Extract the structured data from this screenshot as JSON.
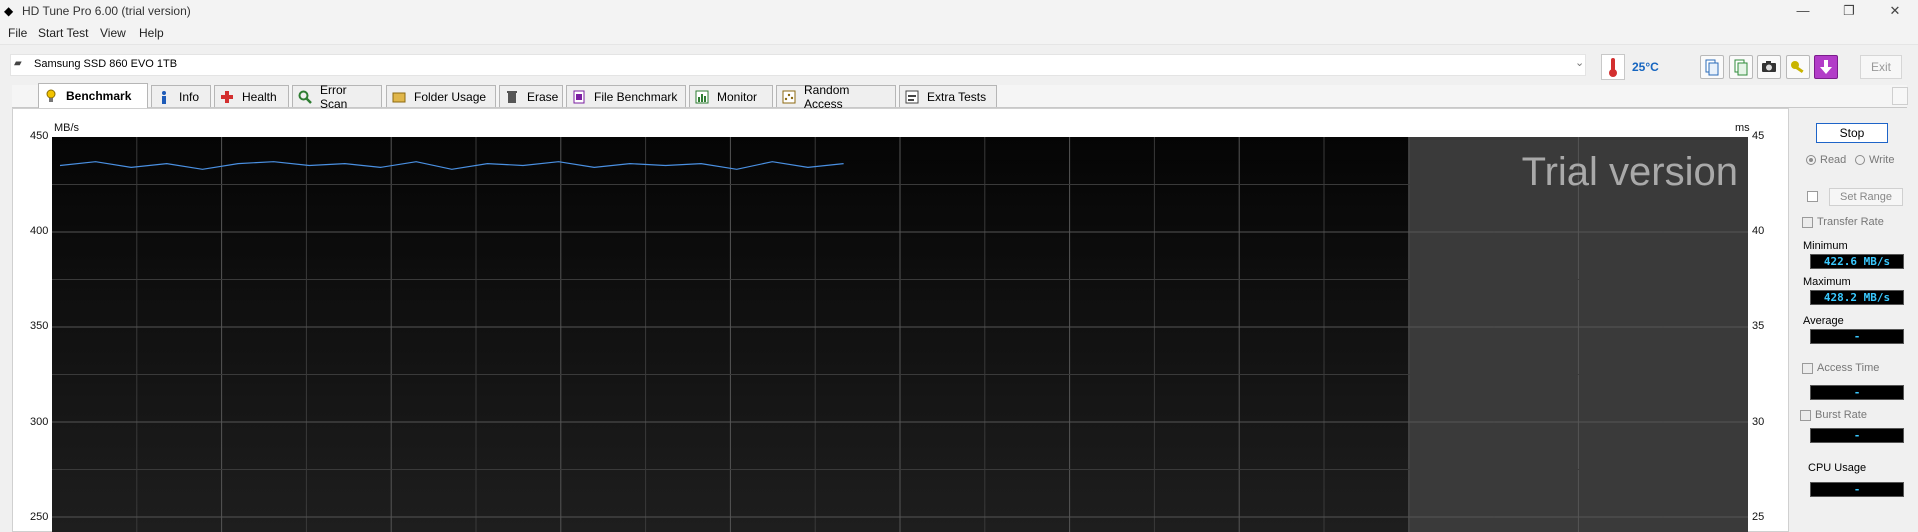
{
  "window": {
    "title": "HD Tune Pro 6.00 (trial version)",
    "minimize": "—",
    "maximize": "❐",
    "close": "✕"
  },
  "menu": [
    "File",
    "Start Test",
    "View",
    "Help"
  ],
  "toolbar": {
    "drive": "Samsung SSD 860 EVO 1TB",
    "temperature": "25°C",
    "exit_label": "Exit",
    "icons": [
      "copy-text-icon",
      "copy-info-icon",
      "screenshot-camera-icon",
      "key-icon",
      "download-arrow-icon"
    ]
  },
  "tabs": [
    {
      "label": "Benchmark",
      "icon": "bulb-icon",
      "active": true
    },
    {
      "label": "Info",
      "icon": "info-icon"
    },
    {
      "label": "Health",
      "icon": "health-cross-icon"
    },
    {
      "label": "Error Scan",
      "icon": "magnifier-icon"
    },
    {
      "label": "Folder Usage",
      "icon": "folder-icon"
    },
    {
      "label": "Erase",
      "icon": "trash-icon"
    },
    {
      "label": "File Benchmark",
      "icon": "file-benchmark-icon"
    },
    {
      "label": "Monitor",
      "icon": "monitor-icon"
    },
    {
      "label": "Random Access",
      "icon": "random-access-icon"
    },
    {
      "label": "Extra Tests",
      "icon": "extra-tests-icon"
    }
  ],
  "chart_data": {
    "type": "line",
    "y_left_label": "MB/s",
    "y_right_label": "ms",
    "y_left_ticks": [
      "450",
      "400",
      "350",
      "300",
      "250"
    ],
    "y_right_ticks": [
      "45",
      "40",
      "35",
      "30",
      "25"
    ],
    "ylim_visible": [
      245,
      450
    ],
    "watermark": "Trial version",
    "grid": true,
    "trial_shaded_from_fraction": 0.8,
    "series": [
      {
        "color": "#4a90e2",
        "x_fraction": [
          0,
          0.0125,
          0.025,
          0.0375,
          0.05,
          0.0625,
          0.075,
          0.0875,
          0.1,
          0.1125,
          0.125,
          0.1375,
          0.15,
          0.1625,
          0.175,
          0.1875,
          0.2,
          0.2125,
          0.225,
          0.2375,
          0.25,
          0.2625,
          0.275
        ],
        "values": [
          435,
          437,
          434,
          436,
          433,
          436,
          437,
          435,
          436,
          434,
          437,
          433,
          436,
          435,
          437,
          434,
          436,
          435,
          436,
          433,
          437,
          434,
          436
        ]
      }
    ]
  },
  "side": {
    "stop_label": "Stop",
    "read_label": "Read",
    "write_label": "Write",
    "set_range_label": "Set Range",
    "transfer_rate_label": "Transfer Rate",
    "minimum_label": "Minimum",
    "minimum_value": "422.6 MB/s",
    "maximum_label": "Maximum",
    "maximum_value": "428.2 MB/s",
    "average_label": "Average",
    "average_value": "-",
    "access_time_label": "Access Time",
    "access_time_value": "-",
    "burst_rate_label": "Burst Rate",
    "burst_rate_value": "-",
    "cpu_usage_label": "CPU Usage",
    "cpu_usage_value": "-"
  }
}
